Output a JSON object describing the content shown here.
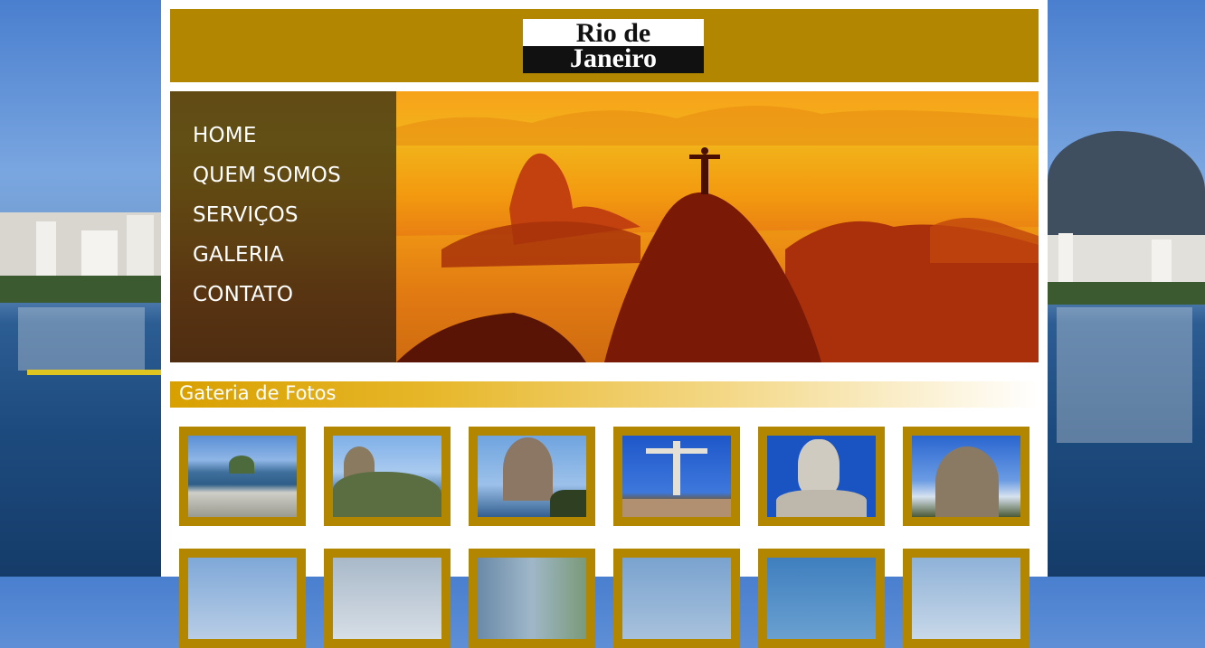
{
  "logo": {
    "line1": "Rio de",
    "line2": "Janeiro"
  },
  "menu": [
    {
      "label": "HOME"
    },
    {
      "label": "QUEM SOMOS"
    },
    {
      "label": "SERVIÇOS"
    },
    {
      "label": "GALERIA"
    },
    {
      "label": "CONTATO"
    }
  ],
  "gallery": {
    "title": "Gateria de Fotos",
    "photos": [
      {
        "name": "rio-bay-aerial-photo"
      },
      {
        "name": "sugarloaf-mountain-photo"
      },
      {
        "name": "sugarloaf-closeup-photo"
      },
      {
        "name": "christ-redeemer-tourists-photo"
      },
      {
        "name": "christ-redeemer-face-photo"
      },
      {
        "name": "pedra-da-gavea-photo"
      }
    ]
  },
  "colors": {
    "accent": "#b38600",
    "menu_overlay": "#282814",
    "page": "#ffffff"
  }
}
